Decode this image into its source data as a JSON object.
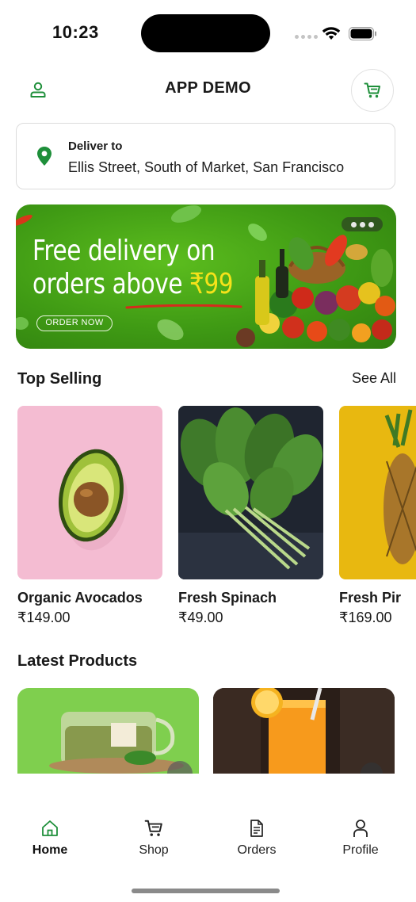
{
  "status_bar": {
    "time": "10:23"
  },
  "header": {
    "title": "APP DEMO",
    "profile_icon": "user-icon",
    "cart_icon": "cart-icon"
  },
  "delivery": {
    "label": "Deliver to",
    "address": "Ellis Street, South of Market, San Francisco",
    "icon": "location-pin-icon"
  },
  "banner": {
    "line1": "Free delivery on",
    "line2_prefix": "orders above ",
    "line2_price": "₹99",
    "cta": "ORDER NOW",
    "dots": 3
  },
  "top_selling": {
    "title": "Top Selling",
    "see_all": "See All",
    "items": [
      {
        "name": "Organic Avocados",
        "price": "₹149.00"
      },
      {
        "name": "Fresh Spinach",
        "price": "₹49.00"
      },
      {
        "name": "Fresh Pir",
        "price": "₹169.00"
      }
    ]
  },
  "latest_products": {
    "title": "Latest Products"
  },
  "tab_bar": {
    "tabs": [
      {
        "label": "Home",
        "icon": "home-icon",
        "active": true
      },
      {
        "label": "Shop",
        "icon": "cart-icon",
        "active": false
      },
      {
        "label": "Orders",
        "icon": "document-icon",
        "active": false
      },
      {
        "label": "Profile",
        "icon": "user-icon",
        "active": false
      }
    ]
  },
  "colors": {
    "accent": "#1e8f3a",
    "banner_green": "#4aa81a",
    "price_yellow": "#f5e21a"
  }
}
